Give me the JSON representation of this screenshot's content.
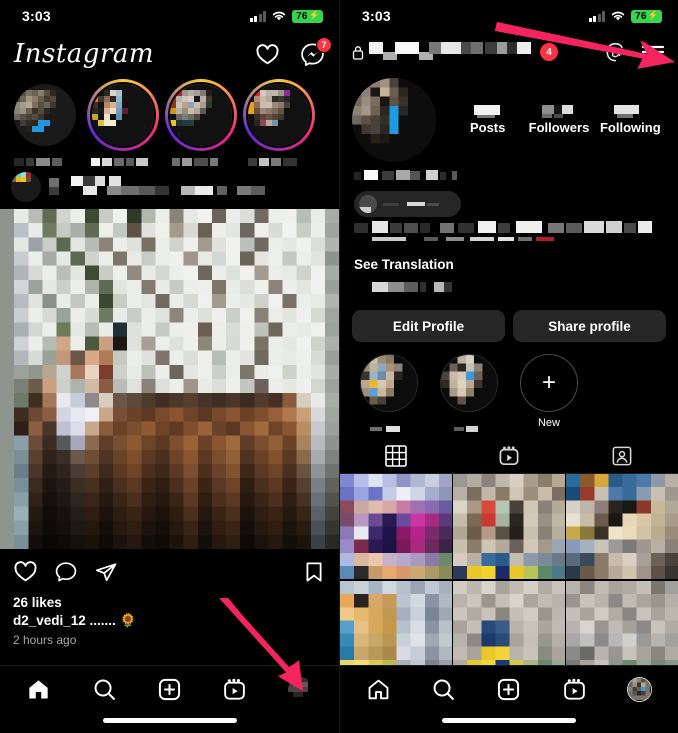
{
  "accent": {
    "arrow": "#f4245e",
    "badge_red": "#ff3040",
    "battery_green": "#32d74b",
    "button_grey": "#262626",
    "background": "#000000"
  },
  "status_bar": {
    "time": "3:03",
    "battery_level": "76",
    "battery_charging_glyph": "⚡",
    "signal_icon": "cellular-signal-icon",
    "wifi_icon": "wifi-icon"
  },
  "left_screen": {
    "name": "instagram-feed",
    "header": {
      "logo_text": "Instagram",
      "like_icon": "heart-icon",
      "messenger_icon": "messenger-icon",
      "messenger_badge": "7"
    },
    "stories": [
      {
        "label_redacted": true
      },
      {
        "label_redacted": true
      },
      {
        "label_redacted": true
      },
      {
        "label_redacted": true
      }
    ],
    "post": {
      "username_redacted": true,
      "like_icon": "heart-icon",
      "comment_icon": "comment-icon",
      "share_icon": "share-icon",
      "save_icon": "bookmark-icon",
      "likes": "26 likes",
      "caption": "d2_vedi_12 ....... 🌻",
      "timestamp": "2 hours ago"
    },
    "tabbar": {
      "home": "home-icon",
      "search": "search-icon",
      "create": "create-icon",
      "reels": "reels-icon",
      "profile": "profile-avatar",
      "active": "home"
    },
    "annotation": {
      "arrow_target": "profile-tab"
    }
  },
  "right_screen": {
    "name": "instagram-profile",
    "header": {
      "lock_icon": "lock-icon",
      "username_redacted": true,
      "username_badge": "4",
      "chevron_icon": "chevron-down-icon",
      "threads_icon": "threads-icon",
      "menu_icon": "hamburger-menu-icon"
    },
    "stats": [
      {
        "label": "Posts",
        "value_redacted": true
      },
      {
        "label": "Followers",
        "value_redacted": true
      },
      {
        "label": "Following",
        "value_redacted": true
      }
    ],
    "bio": {
      "name_redacted": true,
      "threads_pill_redacted": true,
      "text_redacted": true,
      "see_translation": "See Translation",
      "link_redacted": true
    },
    "buttons": {
      "edit_profile": "Edit Profile",
      "share_profile": "Share profile"
    },
    "highlights": [
      {
        "label_redacted": true
      },
      {
        "label_redacted": true
      },
      {
        "label": "New",
        "is_new": true,
        "plus_icon": "plus-icon"
      }
    ],
    "profile_tabs": [
      {
        "icon": "grid-icon",
        "active": true
      },
      {
        "icon": "reels-icon",
        "active": false
      },
      {
        "icon": "tagged-icon",
        "active": false
      }
    ],
    "grid_rows": 2,
    "grid_cols": 3,
    "tabbar": {
      "home": "home-icon",
      "search": "search-icon",
      "create": "create-icon",
      "reels": "reels-icon",
      "profile": "profile-avatar",
      "active": "profile"
    },
    "annotation": {
      "arrow_target": "hamburger-menu-icon"
    }
  }
}
